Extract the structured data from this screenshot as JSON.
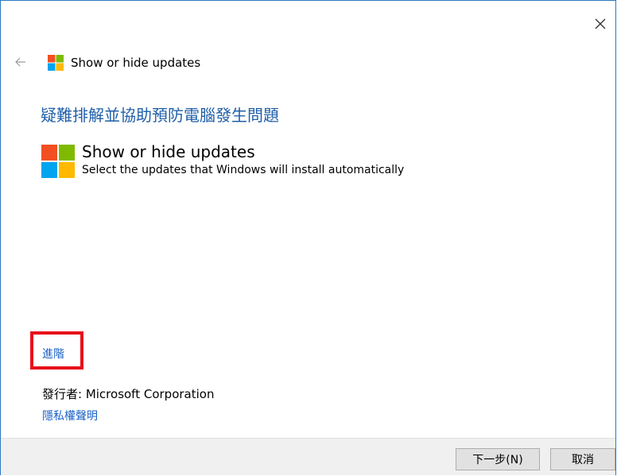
{
  "window": {
    "close_icon": "close-icon",
    "back_icon": "back-arrow-icon",
    "title": "Show or hide updates"
  },
  "main": {
    "heading": "疑難排解並協助預防電腦發生問題",
    "tool_name": "Show or hide updates",
    "tool_desc": "Select the updates that Windows will install automatically",
    "advanced_link": "進階",
    "publisher": "發行者:  Microsoft Corporation",
    "privacy_link": "隱私權聲明"
  },
  "footer": {
    "next_label": "下一步(N)",
    "cancel_label": "取消"
  },
  "colors": {
    "accent": "#1f5fa8",
    "link": "#1a62c5",
    "highlight_box": "#e8101a",
    "logo_red": "#f25022",
    "logo_green": "#7fba00",
    "logo_blue": "#00a4ef",
    "logo_yellow": "#ffb900"
  }
}
